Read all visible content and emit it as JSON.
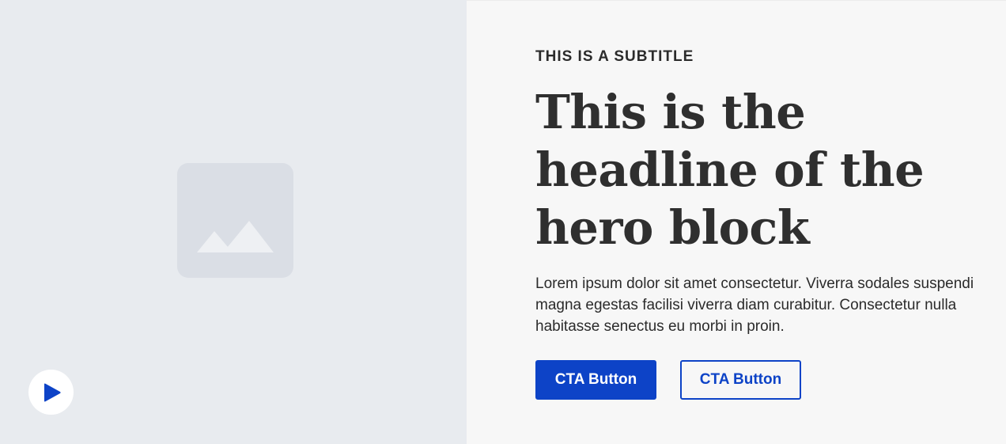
{
  "hero": {
    "subtitle": "THIS IS A SUBTITLE",
    "headline": "This is the headline of the hero block",
    "body": "Lorem ipsum dolor sit amet consectetur. Viverra sodales suspendi magna egestas facilisi viverra diam curabitur. Consectetur nulla habitasse senectus eu morbi in proin.",
    "cta_primary_label": "CTA Button",
    "cta_secondary_label": "CTA Button"
  },
  "media": {
    "placeholder_icon": "image-placeholder-icon",
    "play_icon": "play-icon"
  },
  "colors": {
    "accent": "#0d43c7",
    "media_bg": "#e8ebef",
    "content_bg": "#f7f7f7",
    "text": "#2f2f2f"
  }
}
